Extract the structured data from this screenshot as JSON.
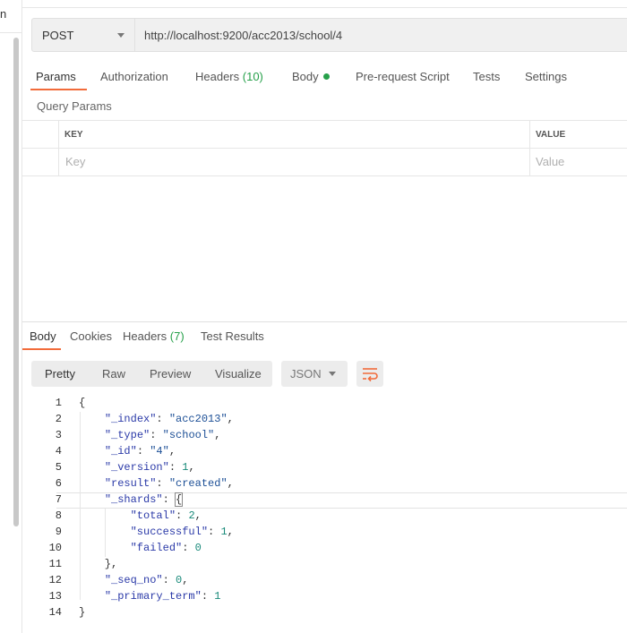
{
  "sidebar": {
    "fragment": "n"
  },
  "request": {
    "method": "POST",
    "url": "http://localhost:9200/acc2013/school/4"
  },
  "request_tabs": [
    {
      "label": "Params",
      "count": ""
    },
    {
      "label": "Authorization",
      "count": ""
    },
    {
      "label": "Headers",
      "count": "(10)"
    },
    {
      "label": "Body",
      "count": ""
    },
    {
      "label": "Pre-request Script",
      "count": ""
    },
    {
      "label": "Tests",
      "count": ""
    },
    {
      "label": "Settings",
      "count": ""
    }
  ],
  "query_params": {
    "title": "Query Params",
    "key_header": "KEY",
    "value_header": "VALUE",
    "key_placeholder": "Key",
    "value_placeholder": "Value"
  },
  "response_tabs": [
    {
      "label": "Body",
      "count": ""
    },
    {
      "label": "Cookies",
      "count": ""
    },
    {
      "label": "Headers",
      "count": "(7)"
    },
    {
      "label": "Test Results",
      "count": ""
    }
  ],
  "view_modes": [
    "Pretty",
    "Raw",
    "Preview",
    "Visualize"
  ],
  "format": "JSON",
  "code_lines": [
    {
      "n": "1",
      "t": "{"
    },
    {
      "n": "2",
      "t": "    \"_index\": \"acc2013\","
    },
    {
      "n": "3",
      "t": "    \"_type\": \"school\","
    },
    {
      "n": "4",
      "t": "    \"_id\": \"4\","
    },
    {
      "n": "5",
      "t": "    \"_version\": 1,"
    },
    {
      "n": "6",
      "t": "    \"result\": \"created\","
    },
    {
      "n": "7",
      "t": "    \"_shards\": {"
    },
    {
      "n": "8",
      "t": "        \"total\": 2,"
    },
    {
      "n": "9",
      "t": "        \"successful\": 1,"
    },
    {
      "n": "10",
      "t": "        \"failed\": 0"
    },
    {
      "n": "11",
      "t": "    },"
    },
    {
      "n": "12",
      "t": "    \"_seq_no\": 0,"
    },
    {
      "n": "13",
      "t": "    \"_primary_term\": 1"
    },
    {
      "n": "14",
      "t": "}"
    }
  ],
  "colors": {
    "accent": "#f26b3a",
    "count_green": "#26a04a"
  }
}
